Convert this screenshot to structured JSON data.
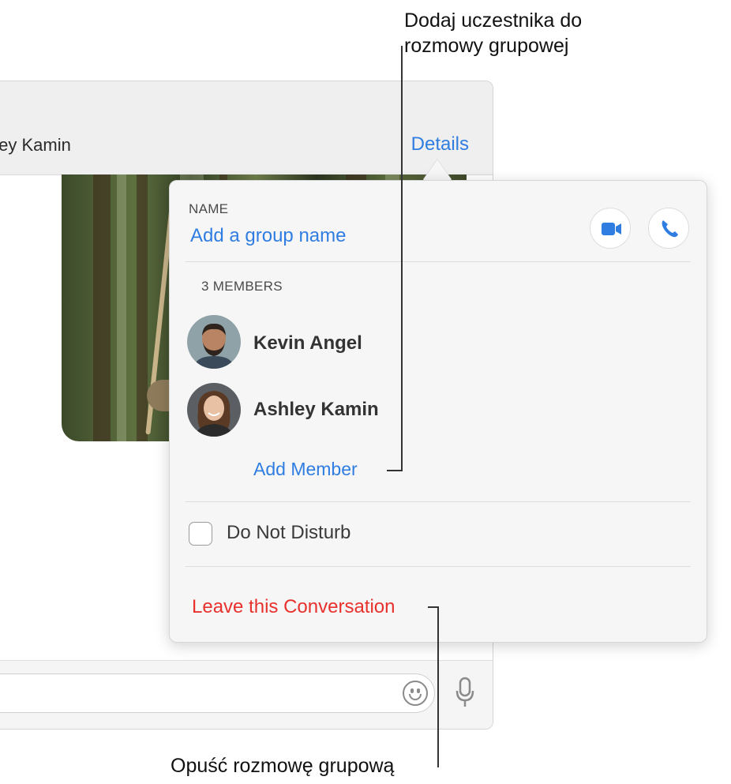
{
  "window": {
    "recipient_partial": "hley Kamin",
    "details_label": "Details"
  },
  "popover": {
    "name_label": "NAME",
    "group_name_placeholder": "Add a group name",
    "members_label": "3 MEMBERS",
    "members": [
      {
        "name": "Kevin Angel"
      },
      {
        "name": "Ashley Kamin"
      }
    ],
    "add_member_label": "Add Member",
    "do_not_disturb_label": "Do Not Disturb",
    "do_not_disturb_checked": false,
    "leave_label": "Leave this Conversation"
  },
  "callouts": {
    "add_member_line1": "Dodaj uczestnika do",
    "add_member_line2": "rozmowy grupowej",
    "leave_text": "Opuść rozmowę grupową"
  },
  "colors": {
    "link": "#2f7de1",
    "destructive": "#e8302c"
  }
}
